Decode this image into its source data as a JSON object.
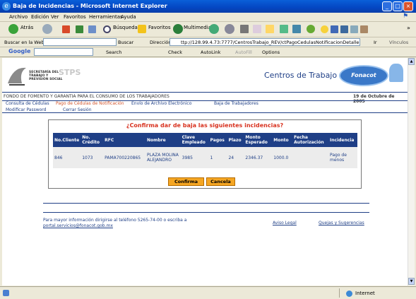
{
  "window": {
    "title": "Baja de Incidencias - Microsoft Internet Explorer"
  },
  "menu": [
    "Archivo",
    "Edición",
    "Ver",
    "Favoritos",
    "Herramientas",
    "Ayuda"
  ],
  "toolbar": {
    "back": "Atrás",
    "search": "Búsqueda",
    "favorites": "Favoritos",
    "multimedia": "Multimedia"
  },
  "address": {
    "search_label": "Buscar en la Web",
    "search_button": "Buscar",
    "label": "Dirección",
    "url": "ttp://128.99.4.73:7777/CentrosTrabajo_REV/ctPagoCedulasNotificacionDetalle.fonacot",
    "go": "Ir",
    "links": "Vínculos"
  },
  "google": {
    "logo": "Google",
    "search": "Search",
    "check": "Check",
    "autolink": "AutoLink",
    "autofill": "AutoFill",
    "options": "Options"
  },
  "header": {
    "logo_text_1": "SECRETARÍA DEL",
    "logo_text_2": "TRABAJO Y",
    "logo_text_3": "PREVISIÓN SOCIAL",
    "logo_stps": "STPS",
    "title": "Centros de Trabajo",
    "fonacot": "Fonacot"
  },
  "org_name": "FONDO DE FOMENTO Y GARANTIA PARA EL CONSUMO DE LOS TRABAJADORES",
  "date": "19 de Octubre de 2005",
  "nav": {
    "consulta": "Consulta de Cédulas",
    "pago": "Pago de Cédulas de Notificación",
    "envio": "Envío de Archivo Electrónico",
    "baja": "Baja de Trabajadores",
    "password": "Modificar Password",
    "cerrar": "Cerrar Sesión"
  },
  "confirm_title": "¿Confirma dar de baja las siguientes incidencias?",
  "table": {
    "headers": [
      "No.Cliente",
      "No. Crédito",
      "RFC",
      "Nombre",
      "Clave Empleado",
      "Pagos",
      "Plazo",
      "Monto Esperado",
      "Monto",
      "Fecha Autorización",
      "Incidencia"
    ],
    "rows": [
      [
        "846",
        "1073",
        "PAMA700220865",
        "PLAZA MOLINA ALEJANDRO",
        "3985",
        "1",
        "24",
        "2346.37",
        "1000.0",
        "",
        "Pago de menos"
      ]
    ]
  },
  "buttons": {
    "confirm": "Confirma",
    "cancel": "Cancela"
  },
  "footer": {
    "info": "Para mayor información dirigirse al teléfono 5265-74-00 o escriba a",
    "email": "portal.servicios@fonacot.gob.mx",
    "aviso": "Aviso Legal",
    "quejas": "Quejas y Sugerencias"
  },
  "status": {
    "zone": "Internet"
  }
}
